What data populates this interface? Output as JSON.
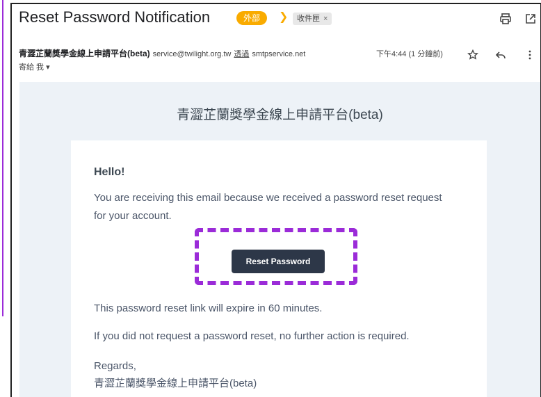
{
  "email": {
    "subject": "Reset Password Notification",
    "tag_external": "外部",
    "tag_inbox": "收件匣",
    "tag_inbox_close": "×",
    "sender_name": "青澀芷蘭獎學金線上申請平台(beta)",
    "sender_address": "service@twilight.org.tw",
    "via_label": "透過",
    "via_domain": "smtpservice.net",
    "timestamp": "下午4:44 (1 分鐘前)",
    "recipient": "寄給 我 ▾"
  },
  "icons": {
    "print": "print-icon",
    "popout": "open-in-new-window-icon",
    "star": "star-icon",
    "reply": "reply-icon",
    "more": "more-vert-icon",
    "important": "important-marker-icon"
  },
  "body": {
    "brand": "青澀芷蘭獎學金線上申請平台(beta)",
    "greeting": "Hello!",
    "intro": "You are receiving this email because we received a password reset request for your account.",
    "button_label": "Reset Password",
    "expiry": "This password reset link will expire in 60 minutes.",
    "no_action": "If you did not request a password reset, no further action is required.",
    "regards": "Regards,",
    "signature": "青澀芷蘭獎學金線上申請平台(beta)"
  },
  "colors": {
    "highlight": "#9b2bd8",
    "button": "#2d3748",
    "tag_external": "#f9ab00",
    "body_background": "#edf2f7"
  }
}
